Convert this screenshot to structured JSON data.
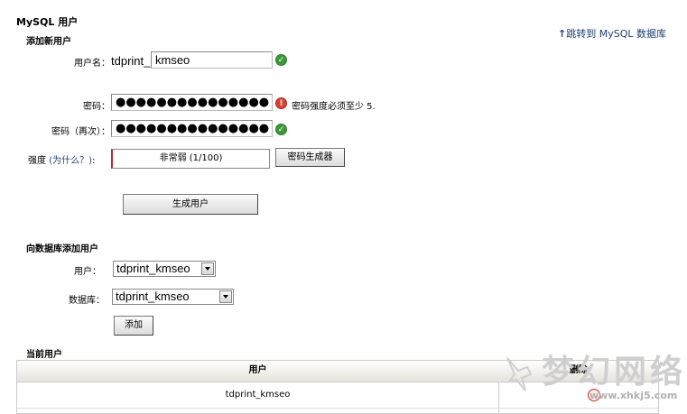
{
  "page": {
    "title": "MySQL 用户",
    "jump_link": "跳转到 MySQL 数据库"
  },
  "add_user": {
    "heading": "添加新用户",
    "username_label": "用户名：",
    "username_prefix": "tdprint_",
    "username_value": "kmseo",
    "password_label": "密码：",
    "password_value": "●●●●●●●●●●●●●●●",
    "password_error": "密码强度必须至少 5.",
    "password_again_label": "密码（再次）：",
    "password_again_value": "●●●●●●●●●●●●●●●",
    "strength_label": "强度",
    "strength_why": "(为什么？)",
    "strength_colon": ":",
    "strength_value": "非常弱 (1/100)",
    "generator_button": "密码生成器",
    "create_button": "生成用户"
  },
  "add_to_db": {
    "heading": "向数据库添加用户",
    "user_label": "用户：",
    "user_selected": "tdprint_kmseo",
    "db_label": "数据库：",
    "db_selected": "tdprint_kmseo",
    "add_button": "添加"
  },
  "current_users": {
    "heading": "当前用户",
    "columns": [
      "用户",
      "删除"
    ],
    "rows": [
      {
        "user": "tdprint_kmseo"
      }
    ]
  },
  "watermark": {
    "text": "梦幻网络",
    "url": "www.xhkj5.com"
  },
  "colors": {
    "link": "#1a3f73",
    "ok": "#3c9a3c",
    "error": "#d9412f",
    "strength_bar": "#c8232c"
  }
}
